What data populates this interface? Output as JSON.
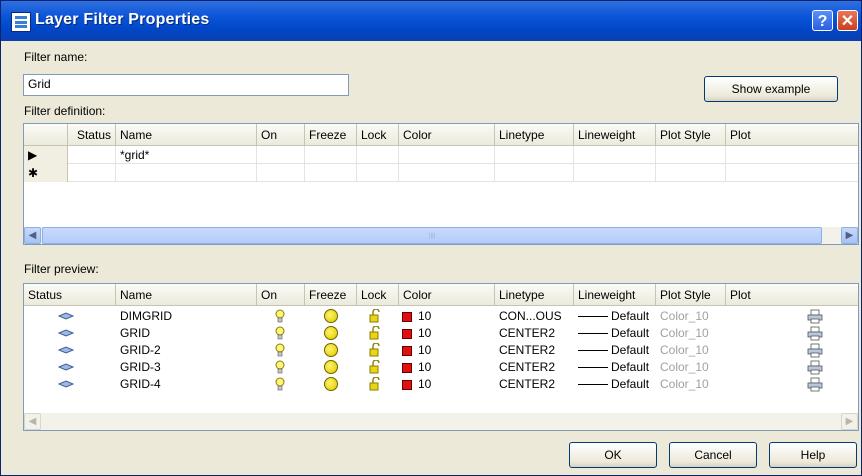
{
  "window": {
    "title": "Layer Filter Properties",
    "help_glyph": "?",
    "close_glyph": "✕"
  },
  "filter_name": {
    "label": "Filter name:",
    "value": "Grid"
  },
  "show_example_label": "Show example",
  "filter_definition": {
    "label": "Filter definition:",
    "columns": [
      "Status",
      "Name",
      "On",
      "Freeze",
      "Lock",
      "Color",
      "Linetype",
      "Lineweight",
      "Plot Style",
      "Plot"
    ],
    "rows": [
      {
        "marker": "▶",
        "name": "*grid*"
      },
      {
        "marker": "✱",
        "name": ""
      }
    ]
  },
  "filter_preview": {
    "label": "Filter preview:",
    "columns": [
      "Status",
      "Name",
      "On",
      "Freeze",
      "Lock",
      "Color",
      "Linetype",
      "Lineweight",
      "Plot Style",
      "Plot"
    ],
    "rows": [
      {
        "name": "DIMGRID",
        "color": "10",
        "linetype": "CON...OUS",
        "lineweight": "Default",
        "plot_style": "Color_10"
      },
      {
        "name": "GRID",
        "color": "10",
        "linetype": "CENTER2",
        "lineweight": "Default",
        "plot_style": "Color_10"
      },
      {
        "name": "GRID-2",
        "color": "10",
        "linetype": "CENTER2",
        "lineweight": "Default",
        "plot_style": "Color_10"
      },
      {
        "name": "GRID-3",
        "color": "10",
        "linetype": "CENTER2",
        "lineweight": "Default",
        "plot_style": "Color_10"
      },
      {
        "name": "GRID-4",
        "color": "10",
        "linetype": "CENTER2",
        "lineweight": "Default",
        "plot_style": "Color_10"
      }
    ]
  },
  "buttons": {
    "ok": "OK",
    "cancel": "Cancel",
    "help": "Help"
  },
  "colors": {
    "titlebar": "#0a54d8",
    "dialog_bg": "#ece9d8",
    "layer_color_red": "#e01010"
  }
}
